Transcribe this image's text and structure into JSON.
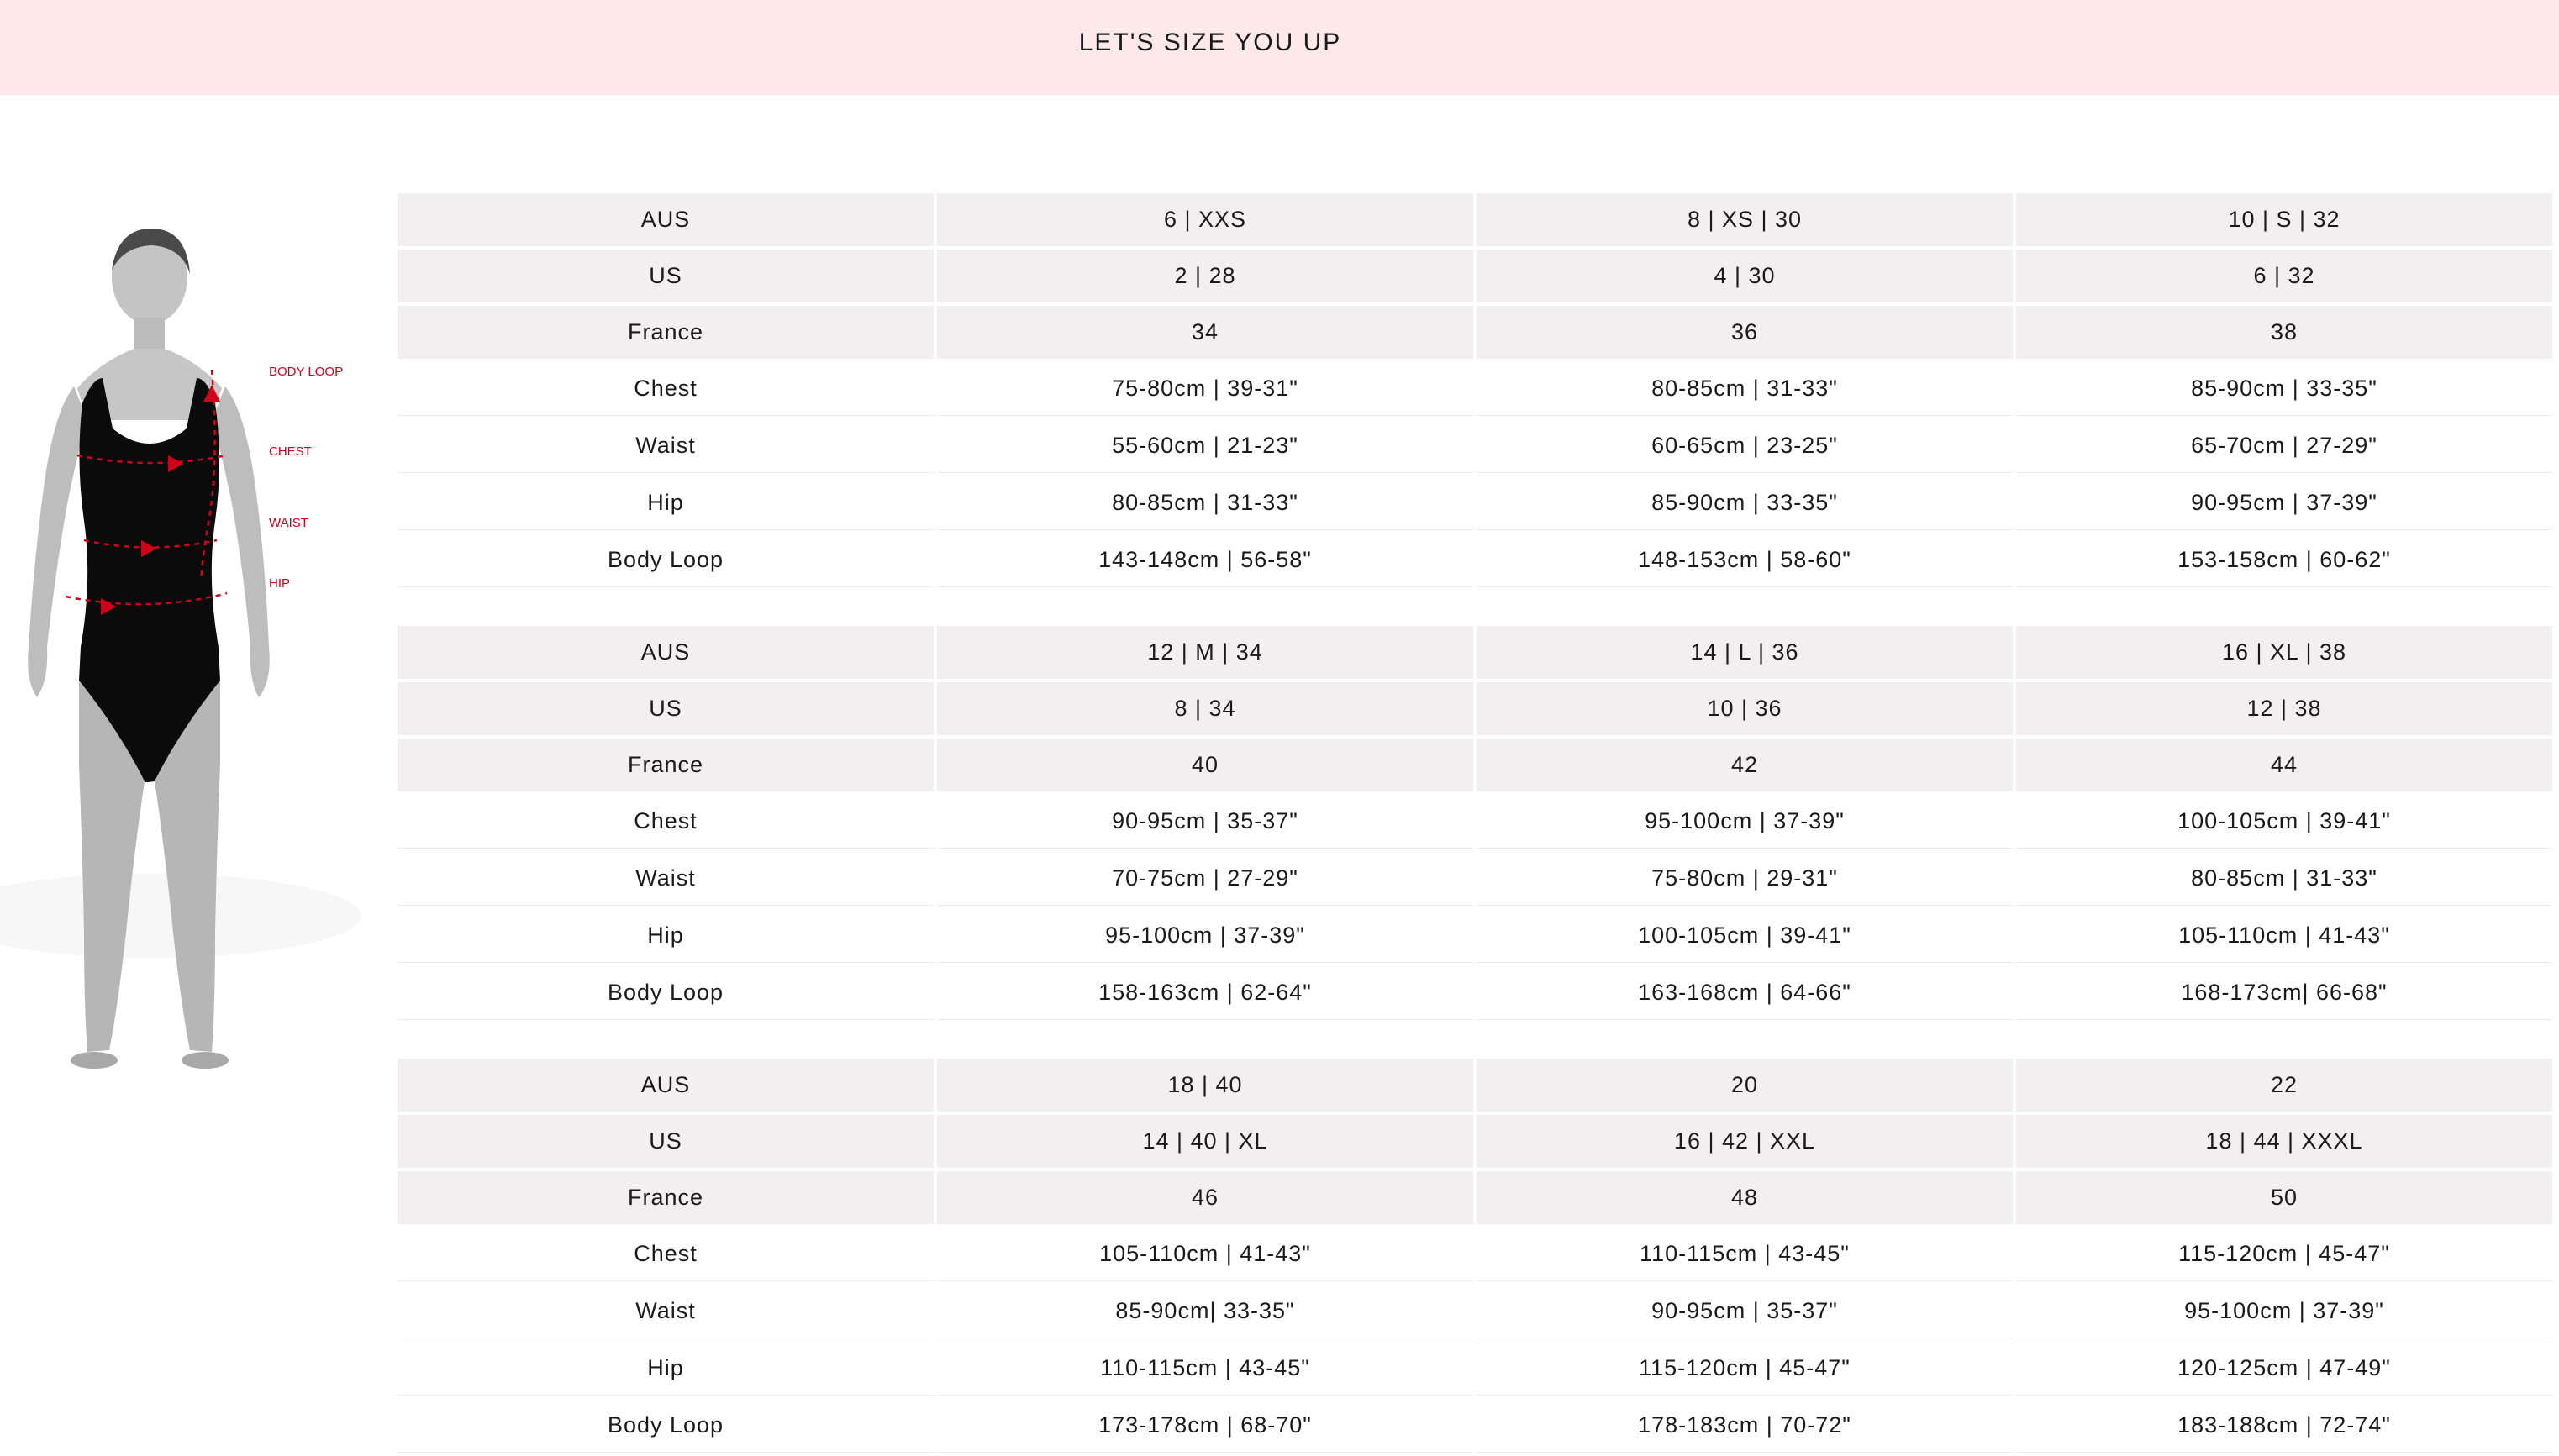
{
  "header": {
    "title": "LET'S SIZE YOU UP"
  },
  "figure": {
    "labels": [
      "BODY LOOP",
      "CHEST",
      "WAIST",
      "HIP"
    ],
    "accent": "#d0021b",
    "suit_color": "#0b0b0b",
    "skin_color": "#bdbdbd"
  },
  "colors": {
    "header_bg": "#fde9e9",
    "row_shade": "#f1eff0",
    "text": "#1a1a1a"
  },
  "tables": [
    {
      "rows": [
        {
          "label": "AUS",
          "shaded": true,
          "values": [
            "6 | XXS",
            "8 | XS | 30",
            "10 | S | 32"
          ]
        },
        {
          "label": "US",
          "shaded": true,
          "values": [
            "2 | 28",
            "4 | 30",
            "6 | 32"
          ]
        },
        {
          "label": "France",
          "shaded": true,
          "values": [
            "34",
            "36",
            "38"
          ]
        },
        {
          "label": "Chest",
          "shaded": false,
          "values": [
            "75-80cm | 39-31\"",
            "80-85cm | 31-33\"",
            "85-90cm | 33-35\""
          ]
        },
        {
          "label": "Waist",
          "shaded": false,
          "values": [
            "55-60cm | 21-23\"",
            "60-65cm | 23-25\"",
            "65-70cm | 27-29\""
          ]
        },
        {
          "label": "Hip",
          "shaded": false,
          "values": [
            "80-85cm | 31-33\"",
            "85-90cm | 33-35\"",
            "90-95cm | 37-39\""
          ]
        },
        {
          "label": "Body Loop",
          "shaded": false,
          "values": [
            "143-148cm | 56-58\"",
            "148-153cm | 58-60\"",
            "153-158cm | 60-62\""
          ]
        }
      ]
    },
    {
      "rows": [
        {
          "label": "AUS",
          "shaded": true,
          "values": [
            "12 | M | 34",
            "14 | L | 36",
            "16 | XL | 38"
          ]
        },
        {
          "label": "US",
          "shaded": true,
          "values": [
            "8 | 34",
            "10 | 36",
            "12 | 38"
          ]
        },
        {
          "label": "France",
          "shaded": true,
          "values": [
            "40",
            "42",
            "44"
          ]
        },
        {
          "label": "Chest",
          "shaded": false,
          "values": [
            "90-95cm | 35-37\"",
            "95-100cm | 37-39\"",
            "100-105cm | 39-41\""
          ]
        },
        {
          "label": "Waist",
          "shaded": false,
          "values": [
            "70-75cm | 27-29\"",
            "75-80cm | 29-31\"",
            "80-85cm | 31-33\""
          ]
        },
        {
          "label": "Hip",
          "shaded": false,
          "values": [
            "95-100cm | 37-39\"",
            "100-105cm | 39-41\"",
            "105-110cm | 41-43\""
          ]
        },
        {
          "label": "Body Loop",
          "shaded": false,
          "values": [
            "158-163cm | 62-64\"",
            "163-168cm | 64-66\"",
            "168-173cm| 66-68\""
          ]
        }
      ]
    },
    {
      "rows": [
        {
          "label": "AUS",
          "shaded": true,
          "values": [
            "18 | 40",
            "20",
            "22"
          ]
        },
        {
          "label": "US",
          "shaded": true,
          "values": [
            "14 | 40 | XL",
            "16 | 42 | XXL",
            "18 | 44 | XXXL"
          ]
        },
        {
          "label": "France",
          "shaded": true,
          "values": [
            "46",
            "48",
            "50"
          ]
        },
        {
          "label": "Chest",
          "shaded": false,
          "values": [
            "105-110cm | 41-43\"",
            "110-115cm | 43-45\"",
            "115-120cm | 45-47\""
          ]
        },
        {
          "label": "Waist",
          "shaded": false,
          "values": [
            "85-90cm| 33-35\"",
            "90-95cm | 35-37\"",
            "95-100cm | 37-39\""
          ]
        },
        {
          "label": "Hip",
          "shaded": false,
          "values": [
            "110-115cm | 43-45\"",
            "115-120cm | 45-47\"",
            "120-125cm | 47-49\""
          ]
        },
        {
          "label": "Body Loop",
          "shaded": false,
          "values": [
            "173-178cm | 68-70\"",
            "178-183cm | 70-72\"",
            "183-188cm | 72-74\""
          ]
        }
      ]
    }
  ]
}
